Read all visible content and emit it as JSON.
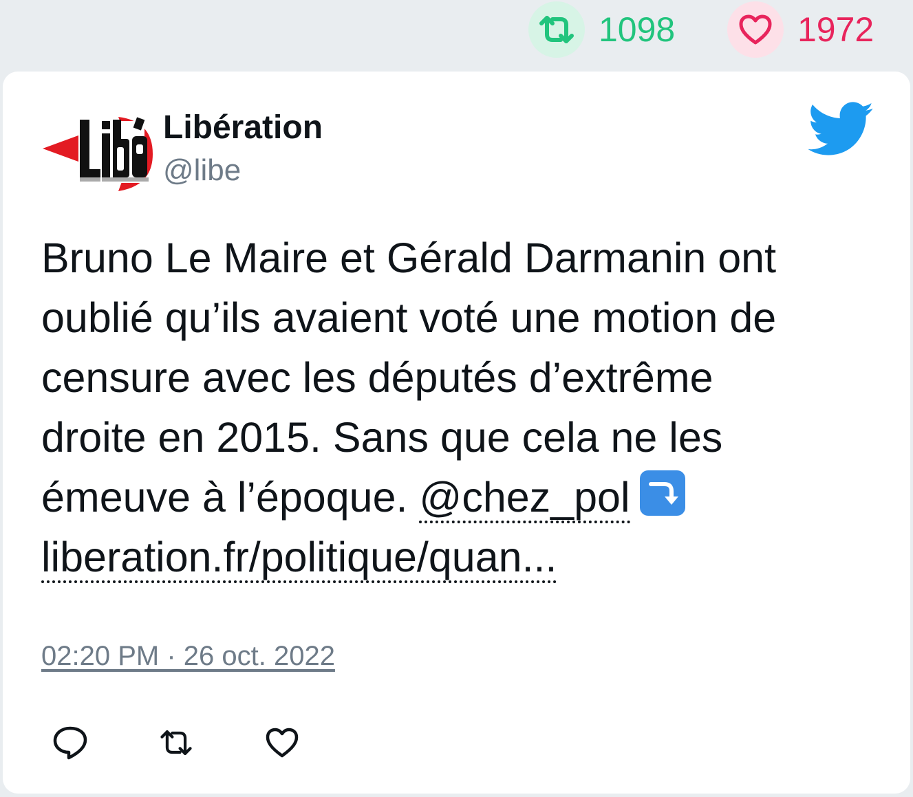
{
  "stats": {
    "retweets": "1098",
    "likes": "1972",
    "retweet_color": "#21c47d",
    "like_color": "#e8245c"
  },
  "tweet": {
    "author_name": "Libération",
    "author_handle": "@libe",
    "text_lines": [
      "Bruno Le Maire et Gérald Darmanin ont",
      "oublié qu’ils avaient voté une motion de",
      "censure avec les députés d’extrême",
      "droite en 2015. Sans que cela ne les",
      "émeuve à l’époque. "
    ],
    "mention": "@chez_pol",
    "emoji": "right-arrow-curving-down",
    "link": "liberation.fr/politique/quan...",
    "timestamp": "02:20 PM · 26 oct. 2022"
  },
  "icons": {
    "avatar": "libe-logo",
    "brand": "twitter-bird-icon",
    "actions": [
      "reply-icon",
      "retweet-icon",
      "like-icon"
    ]
  },
  "colors": {
    "twitter_blue": "#1d9bf0",
    "text": "#0f1419",
    "secondary": "#6e7b88"
  }
}
